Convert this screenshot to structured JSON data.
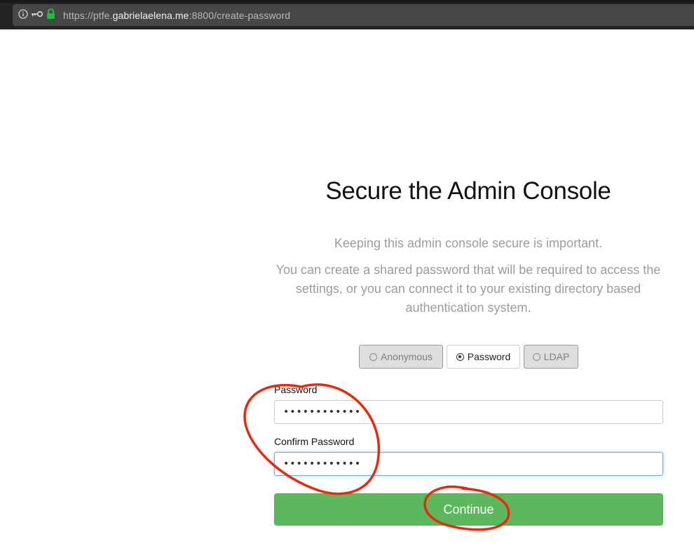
{
  "browser": {
    "url_prefix": "https://ptfe.",
    "url_host": "gabrielaelena.me",
    "url_suffix": ":8800/create-password",
    "icons": [
      "info-icon",
      "key-icon",
      "lock-icon"
    ]
  },
  "page": {
    "title": "Secure the Admin Console",
    "lead": "Keeping this admin console secure is important.",
    "description": "You can create a shared password that will be required to access the settings, or you can connect it to your existing directory based authentication system."
  },
  "auth_options": {
    "selected": "Password",
    "items": [
      {
        "label": "Anonymous",
        "selected": false
      },
      {
        "label": "Password",
        "selected": true
      },
      {
        "label": "LDAP",
        "selected": false
      }
    ]
  },
  "form": {
    "password_label": "Password",
    "password_value": "••••••••••••",
    "confirm_label": "Confirm Password",
    "confirm_value": "••••••••••••",
    "continue_label": "Continue"
  },
  "colors": {
    "continue_button": "#5cb85c",
    "annotation_red": "#e8290c"
  }
}
